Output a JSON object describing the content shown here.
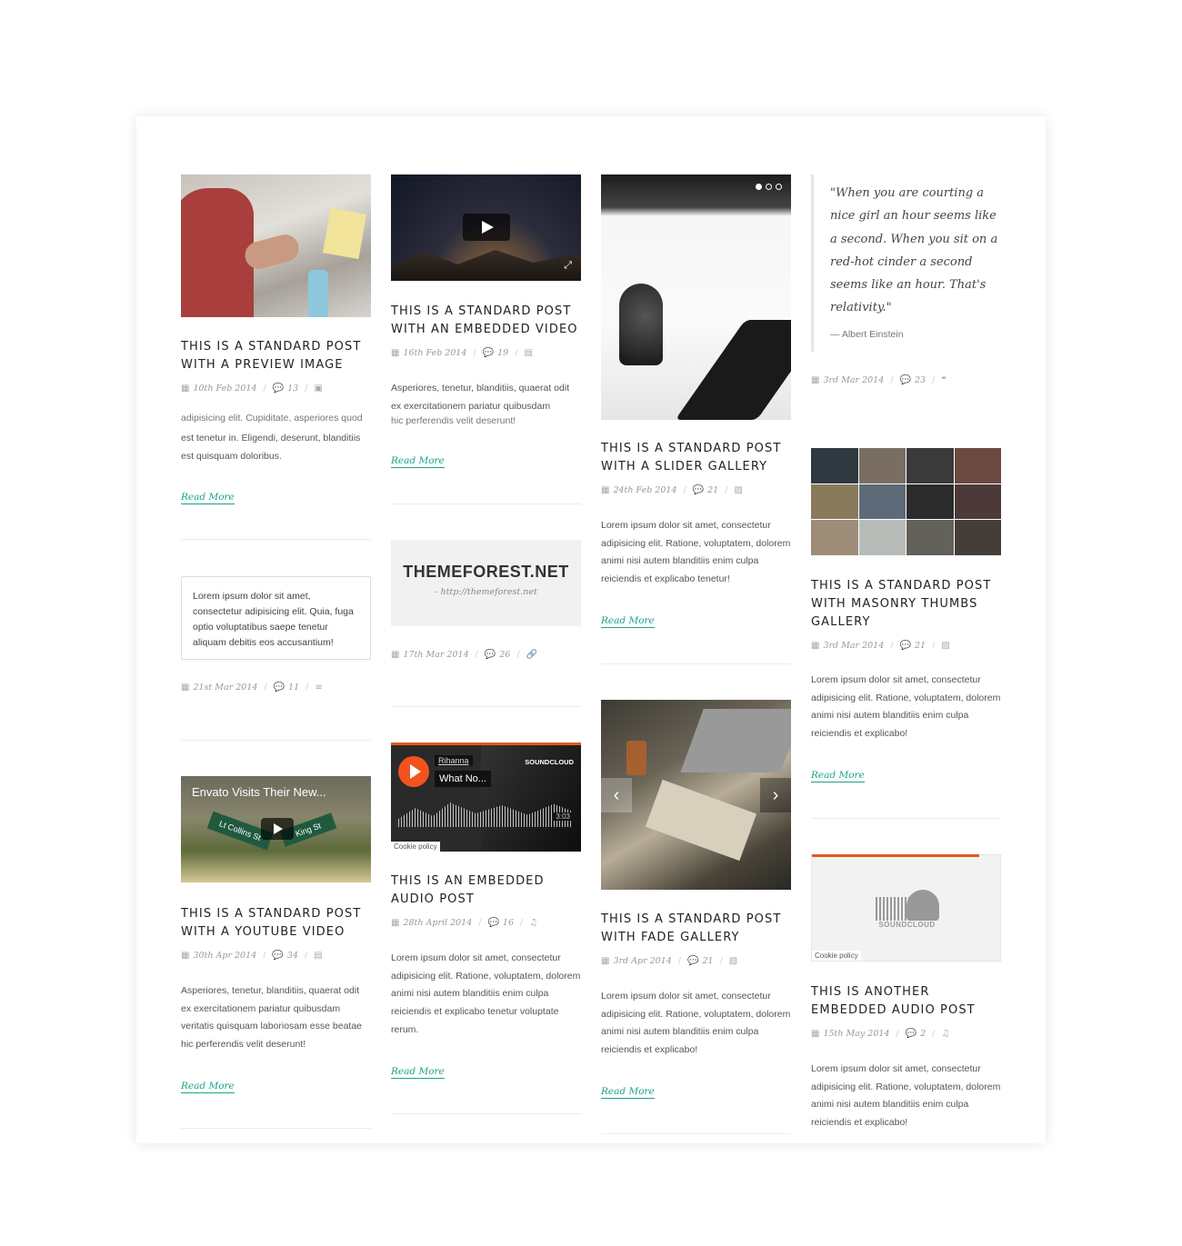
{
  "posts": {
    "preview": {
      "title": "THIS IS A STANDARD POST WITH A PREVIEW IMAGE",
      "date": "10th Feb 2014",
      "comments": "13",
      "excerpt_partial": "adipisicing elit. Cupiditate, asperiores quod",
      "excerpt": "est tenetur in. Eligendi, deserunt, blanditiis est quisquam doloribus.",
      "read_more": "Read More"
    },
    "video": {
      "title": "THIS IS A STANDARD POST WITH AN EMBEDDED VIDEO",
      "date": "16th Feb 2014",
      "comments": "19",
      "excerpt": "Asperiores, tenetur, blanditiis, quaerat odit ex exercitationem pariatur quibusdam",
      "excerpt_partial": "hic perferendis velit deserunt!",
      "read_more": "Read More"
    },
    "slider": {
      "title": "THIS IS A STANDARD POST WITH A SLIDER GALLERY",
      "date": "24th Feb 2014",
      "comments": "21",
      "excerpt": "Lorem ipsum dolor sit amet, consectetur adipisicing elit. Ratione, voluptatem, dolorem animi nisi autem blanditiis enim culpa reiciendis et explicabo tenetur!",
      "read_more": "Read More"
    },
    "quote": {
      "text": "\"When you are courting a nice girl an hour seems like a second. When you sit on a red-hot cinder a second seems like an hour. That's relativity.\"",
      "author": "— Albert Einstein",
      "date": "3rd Mar 2014",
      "comments": "23"
    },
    "masonry": {
      "title": "THIS IS A STANDARD POST WITH MASONRY THUMBS GALLERY",
      "date": "3rd Mar 2014",
      "comments": "21",
      "excerpt": "Lorem ipsum dolor sit amet, consectetur adipisicing elit. Ratione, voluptatem, dolorem animi nisi autem blanditiis enim culpa reiciendis et explicabo!",
      "read_more": "Read More"
    },
    "status": {
      "text": "Lorem ipsum dolor sit amet, consectetur adipisicing elit. Quia, fuga optio voluptatibus saepe tenetur aliquam debitis eos accusantium!",
      "date": "21st Mar 2014",
      "comments": "11"
    },
    "link": {
      "title": "THEMEFOREST.NET",
      "url": "- http://themeforest.net",
      "date": "17th Mar 2014",
      "comments": "26"
    },
    "youtube": {
      "video_title": "Envato Visits Their New...",
      "sign1": "Lt Collins St",
      "sign2": "King St",
      "title": "THIS IS A STANDARD POST WITH A YOUTUBE VIDEO",
      "date": "30th Apr 2014",
      "comments": "34",
      "excerpt": "Asperiores, tenetur, blanditiis, quaerat odit ex exercitationem pariatur quibusdam veritatis quisquam laboriosam esse beatae hic perferendis velit deserunt!",
      "read_more": "Read More"
    },
    "audio": {
      "artist": "Rihanna",
      "track": "What No...",
      "logo": "SOUNDCLOUD",
      "time": "3:03",
      "cookie": "Cookie policy",
      "title": "THIS IS AN EMBEDDED AUDIO POST",
      "date": "28th April 2014",
      "comments": "16",
      "excerpt": "Lorem ipsum dolor sit amet, consectetur adipisicing elit. Ratione, voluptatem, dolorem animi nisi autem blanditiis enim culpa reiciendis et explicabo tenetur voluptate rerum.",
      "read_more": "Read More"
    },
    "fade": {
      "title": "THIS IS A STANDARD POST WITH FADE GALLERY",
      "date": "3rd Apr 2014",
      "comments": "21",
      "excerpt": "Lorem ipsum dolor sit amet, consectetur adipisicing elit. Ratione, voluptatem, dolorem animi nisi autem blanditiis enim culpa reiciendis et explicabo!",
      "read_more": "Read More"
    },
    "audio2": {
      "logo": "SOUNDCLOUD",
      "cookie": "Cookie policy",
      "title": "THIS IS ANOTHER EMBEDDED AUDIO POST",
      "date": "15th May 2014",
      "comments": "2",
      "excerpt": "Lorem ipsum dolor sit amet, consectetur adipisicing elit. Ratione, voluptatem, dolorem animi nisi autem blanditiis enim culpa reiciendis et explicabo!"
    }
  },
  "colors": {
    "accent": "#1aa38a",
    "soundcloud": "#e25a1c",
    "title": "#222222",
    "meta": "#999999"
  }
}
